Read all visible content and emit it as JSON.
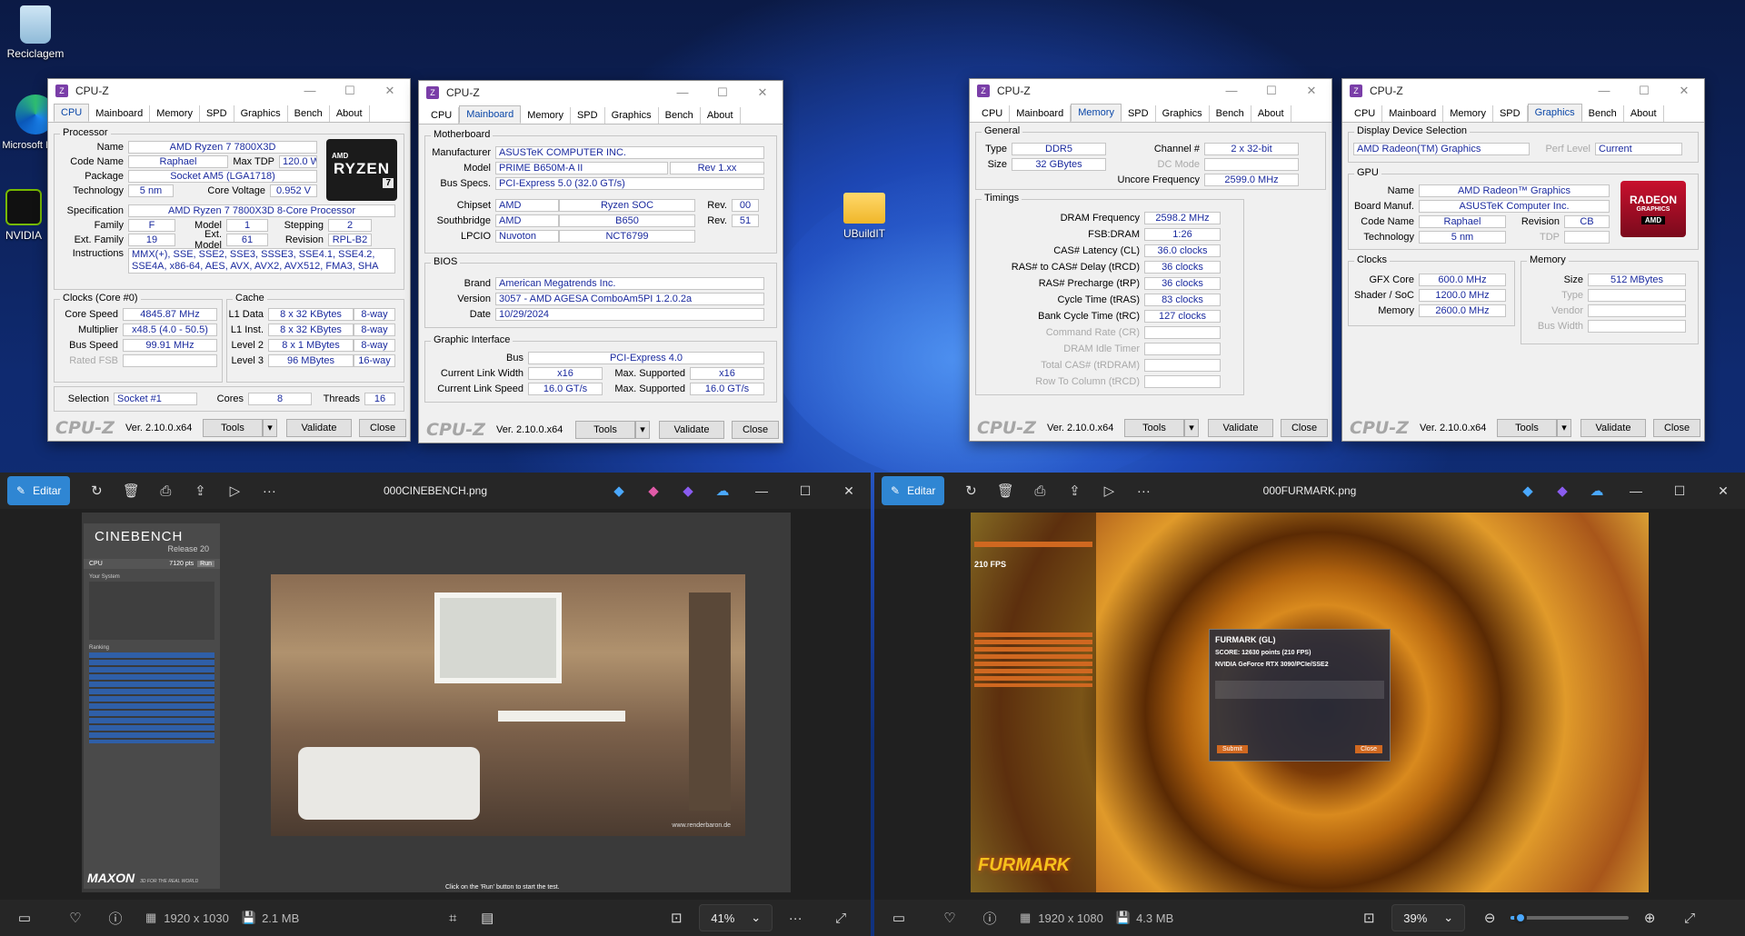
{
  "desktop": {
    "recycle": "Reciclagem",
    "edge": "Microsoft Edge",
    "nvidia": "NVIDIA",
    "folder": "UBuildIT"
  },
  "common": {
    "app": "CPU-Z",
    "logo": "CPU-Z",
    "version": "Ver. 2.10.0.x64",
    "tools": "Tools",
    "validate": "Validate",
    "close": "Close",
    "tabs": [
      "CPU",
      "Mainboard",
      "Memory",
      "SPD",
      "Graphics",
      "Bench",
      "About"
    ]
  },
  "cpu": {
    "group": "Processor",
    "name_l": "Name",
    "name": "AMD Ryzen 7 7800X3D",
    "codename_l": "Code Name",
    "codename": "Raphael",
    "maxtdp_l": "Max TDP",
    "maxtdp": "120.0 W",
    "package_l": "Package",
    "package": "Socket AM5 (LGA1718)",
    "tech_l": "Technology",
    "tech": "5 nm",
    "corevolt_l": "Core Voltage",
    "corevolt": "0.952 V",
    "spec_l": "Specification",
    "spec": "AMD Ryzen 7 7800X3D 8-Core Processor",
    "family_l": "Family",
    "family": "F",
    "model_l": "Model",
    "model": "1",
    "stepping_l": "Stepping",
    "stepping": "2",
    "extfam_l": "Ext. Family",
    "extfam": "19",
    "extmodel_l": "Ext. Model",
    "extmodel": "61",
    "revision_l": "Revision",
    "revision": "RPL-B2",
    "instr_l": "Instructions",
    "instr": "MMX(+), SSE, SSE2, SSE3, SSSE3, SSE4.1, SSE4.2, SSE4A, x86-64, AES, AVX, AVX2, AVX512, FMA3, SHA",
    "clocks_g": "Clocks (Core #0)",
    "corespeed_l": "Core Speed",
    "corespeed": "4845.87 MHz",
    "mult_l": "Multiplier",
    "mult": "x48.5 (4.0 - 50.5)",
    "bus_l": "Bus Speed",
    "bus": "99.91 MHz",
    "fsb_l": "Rated FSB",
    "cache_g": "Cache",
    "l1d_l": "L1 Data",
    "l1d": "8 x 32 KBytes",
    "l1d_w": "8-way",
    "l1i_l": "L1 Inst.",
    "l1i": "8 x 32 KBytes",
    "l1i_w": "8-way",
    "l2_l": "Level 2",
    "l2": "8 x 1 MBytes",
    "l2_w": "8-way",
    "l3_l": "Level 3",
    "l3": "96 MBytes",
    "l3_w": "16-way",
    "sel_l": "Selection",
    "sel": "Socket #1",
    "cores_l": "Cores",
    "cores": "8",
    "threads_l": "Threads",
    "threads": "16",
    "brand_a": "AMD",
    "brand_b": "RYZEN",
    "brand_c": "7"
  },
  "mb": {
    "group": "Motherboard",
    "manu_l": "Manufacturer",
    "manu": "ASUSTeK COMPUTER INC.",
    "model_l": "Model",
    "model": "PRIME B650M-A II",
    "rev": "Rev 1.xx",
    "bus_l": "Bus Specs.",
    "bus": "PCI-Express 5.0 (32.0 GT/s)",
    "chip_l": "Chipset",
    "chip_a": "AMD",
    "chip_b": "Ryzen SOC",
    "chip_rev_l": "Rev.",
    "chip_rev": "00",
    "sb_l": "Southbridge",
    "sb_a": "AMD",
    "sb_b": "B650",
    "sb_rev_l": "Rev.",
    "sb_rev": "51",
    "lpcio_l": "LPCIO",
    "lpcio_a": "Nuvoton",
    "lpcio_b": "NCT6799",
    "bios_g": "BIOS",
    "brand_l": "Brand",
    "brand": "American Megatrends Inc.",
    "ver_l": "Version",
    "ver": "3057 - AMD AGESA ComboAm5PI 1.2.0.2a",
    "date_l": "Date",
    "date": "10/29/2024",
    "gi_g": "Graphic Interface",
    "gbus_l": "Bus",
    "gbus": "PCI-Express 4.0",
    "clw_l": "Current Link Width",
    "clw": "x16",
    "msw_l": "Max. Supported",
    "msw": "x16",
    "cls_l": "Current Link Speed",
    "cls": "16.0 GT/s",
    "mss_l": "Max. Supported",
    "mss": "16.0 GT/s"
  },
  "mem": {
    "gen_g": "General",
    "type_l": "Type",
    "type": "DDR5",
    "chan_l": "Channel #",
    "chan": "2 x 32-bit",
    "size_l": "Size",
    "size": "32 GBytes",
    "dc_l": "DC Mode",
    "unc_l": "Uncore Frequency",
    "unc": "2599.0 MHz",
    "tim_g": "Timings",
    "dram_l": "DRAM Frequency",
    "dram": "2598.2 MHz",
    "fsb_l": "FSB:DRAM",
    "fsb": "1:26",
    "cl_l": "CAS# Latency (CL)",
    "cl": "36.0 clocks",
    "rcd_l": "RAS# to CAS# Delay (tRCD)",
    "rcd": "36 clocks",
    "rp_l": "RAS# Precharge (tRP)",
    "rp": "36 clocks",
    "ras_l": "Cycle Time (tRAS)",
    "ras": "83 clocks",
    "rc_l": "Bank Cycle Time (tRC)",
    "rc": "127 clocks",
    "cr_l": "Command Rate (CR)",
    "idle_l": "DRAM Idle Timer",
    "trdram_l": "Total CAS# (tRDRAM)",
    "trcd2_l": "Row To Column (tRCD)"
  },
  "gfx": {
    "dsel_g": "Display Device Selection",
    "device": "AMD Radeon(TM) Graphics",
    "perf_l": "Perf Level",
    "perf": "Current",
    "gpu_g": "GPU",
    "name_l": "Name",
    "name": "AMD Radeon™ Graphics",
    "bm_l": "Board Manuf.",
    "bm": "ASUSTeK Computer Inc.",
    "cn_l": "Code Name",
    "cn": "Raphael",
    "rev_l": "Revision",
    "rev": "CB",
    "tech_l": "Technology",
    "tech": "5 nm",
    "tdp_l": "TDP",
    "clk_g": "Clocks",
    "core_l": "GFX Core",
    "core": "600.0 MHz",
    "shader_l": "Shader / SoC",
    "shader": "1200.0 MHz",
    "memc_l": "Memory",
    "memc": "2600.0 MHz",
    "memg": "Memory",
    "size_l": "Size",
    "size": "512 MBytes",
    "type_l": "Type",
    "vendor_l": "Vendor",
    "bw_l": "Bus Width",
    "logo_a": "RADEON",
    "logo_b": "GRAPHICS",
    "logo_c": "AMD"
  },
  "photo1": {
    "edit": "Editar",
    "file": "000CINEBENCH.png",
    "dims": "1920 x 1030",
    "size": "2.1 MB",
    "zoom": "41%",
    "cb_title": "CINEBENCH",
    "cb_release": "Release 20",
    "cb_cpu_l": "CPU",
    "cb_score": "7120 pts",
    "cb_run": "Run",
    "cb_sys": "Your System",
    "cb_rank": "Ranking",
    "cb_maxon": "MAXON",
    "cb_maxon_tag": "3D FOR THE REAL WORLD",
    "cb_hint": "Click on the 'Run' button to start the test.",
    "cb_wm": "www.renderbaron.de"
  },
  "photo2": {
    "edit": "Editar",
    "file": "000FURMARK.png",
    "dims": "1920 x 1080",
    "size": "4.3 MB",
    "zoom": "39%",
    "fm_fps": "210 FPS",
    "fm_head": "FURMARK (GL)",
    "fm_score": "SCORE: 12630 points (210 FPS)",
    "fm_gpu": "NVIDIA GeForce RTX 3090/PCIe/SSE2",
    "fm_logo": "FURMARK",
    "fm_close": "Close",
    "fm_submit": "Submit"
  }
}
